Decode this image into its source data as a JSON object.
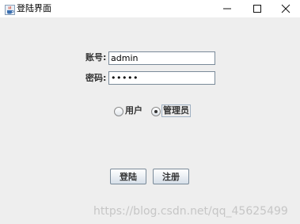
{
  "window": {
    "title": "登陆界面",
    "icon": "java-cup-icon"
  },
  "form": {
    "account_label": "账号:",
    "account_value": "admin",
    "password_label": "密码:",
    "password_value": "•••••"
  },
  "role": {
    "options": [
      {
        "label": "用户",
        "selected": false
      },
      {
        "label": "管理员",
        "selected": true
      }
    ]
  },
  "buttons": {
    "login_label": "登陆",
    "register_label": "注册"
  },
  "watermark": "https://blog.csdn.net/qq_45625499",
  "colors": {
    "client_bg": "#eeeeee",
    "titlebar_bg": "#ffffff",
    "field_border": "#7a8a99"
  }
}
